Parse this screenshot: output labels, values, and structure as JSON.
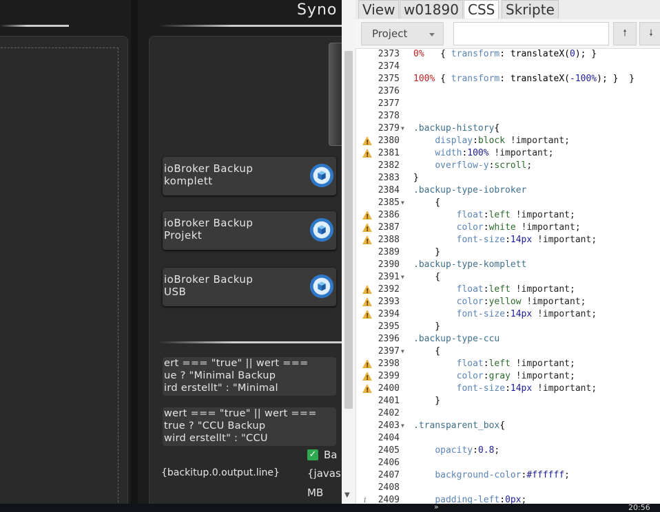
{
  "app": {
    "title": "Syno",
    "buttons": [
      {
        "label": "ioBroker Backup\nkomplett"
      },
      {
        "label": "ioBroker Backup\nProjekt"
      },
      {
        "label": "ioBroker Backup\nUSB"
      }
    ],
    "code_boxes": [
      {
        "text": "ert === \"true\" || wert ===\nue ? \"Minimal Backup\nird erstellt\" : \"Minimal"
      },
      {
        "text": "wert === \"true\" || wert ===\ntrue ? \"CCU Backup\nwird erstellt\" : \"CCU"
      }
    ],
    "output_line": "{backitup.0.output.line}",
    "checkbox_label": "Ba",
    "js_text": "{javas",
    "mb_text": "MB"
  },
  "editor": {
    "tabs": [
      "View",
      "w01890",
      "CSS",
      "Skripte"
    ],
    "active_tab": "CSS",
    "project_select": "Project",
    "search_placeholder": "",
    "nav_up": "🠕",
    "nav_down": "🠗",
    "lines": [
      {
        "n": "2373",
        "marker": "",
        "fold": false,
        "text": "0%   { transform: translateX(0); }"
      },
      {
        "n": "2374",
        "marker": "",
        "fold": false,
        "text": ""
      },
      {
        "n": "2375",
        "marker": "",
        "fold": false,
        "text": "100% { transform: translateX(-100%); }  }"
      },
      {
        "n": "2376",
        "marker": "",
        "fold": false,
        "text": ""
      },
      {
        "n": "2377",
        "marker": "",
        "fold": false,
        "text": ""
      },
      {
        "n": "2378",
        "marker": "",
        "fold": false,
        "text": ""
      },
      {
        "n": "2379",
        "marker": "",
        "fold": true,
        "text": ".backup-history{"
      },
      {
        "n": "2380",
        "marker": "warn",
        "fold": false,
        "text": "    display:block !important;"
      },
      {
        "n": "2381",
        "marker": "warn",
        "fold": false,
        "text": "    width:100% !important;"
      },
      {
        "n": "2382",
        "marker": "",
        "fold": false,
        "text": "    overflow-y:scroll;"
      },
      {
        "n": "2383",
        "marker": "",
        "fold": false,
        "text": "}"
      },
      {
        "n": "2384",
        "marker": "",
        "fold": false,
        "text": ".backup-type-iobroker"
      },
      {
        "n": "2385",
        "marker": "",
        "fold": true,
        "text": "    {"
      },
      {
        "n": "2386",
        "marker": "warn",
        "fold": false,
        "text": "        float:left !important;"
      },
      {
        "n": "2387",
        "marker": "warn",
        "fold": false,
        "text": "        color:white !important;"
      },
      {
        "n": "2388",
        "marker": "warn",
        "fold": false,
        "text": "        font-size:14px !important;"
      },
      {
        "n": "2389",
        "marker": "",
        "fold": false,
        "text": "    }"
      },
      {
        "n": "2390",
        "marker": "",
        "fold": false,
        "text": ".backup-type-komplett"
      },
      {
        "n": "2391",
        "marker": "",
        "fold": true,
        "text": "    {"
      },
      {
        "n": "2392",
        "marker": "warn",
        "fold": false,
        "text": "        float:left !important;"
      },
      {
        "n": "2393",
        "marker": "warn",
        "fold": false,
        "text": "        color:yellow !important;"
      },
      {
        "n": "2394",
        "marker": "warn",
        "fold": false,
        "text": "        font-size:14px !important;"
      },
      {
        "n": "2395",
        "marker": "",
        "fold": false,
        "text": "    }"
      },
      {
        "n": "2396",
        "marker": "",
        "fold": false,
        "text": ".backup-type-ccu"
      },
      {
        "n": "2397",
        "marker": "",
        "fold": true,
        "text": "    {"
      },
      {
        "n": "2398",
        "marker": "warn",
        "fold": false,
        "text": "        float:left !important;"
      },
      {
        "n": "2399",
        "marker": "warn",
        "fold": false,
        "text": "        color:gray !important;"
      },
      {
        "n": "2400",
        "marker": "warn",
        "fold": false,
        "text": "        font-size:14px !important;"
      },
      {
        "n": "2401",
        "marker": "",
        "fold": false,
        "text": "    }"
      },
      {
        "n": "2402",
        "marker": "",
        "fold": false,
        "text": ""
      },
      {
        "n": "2403",
        "marker": "",
        "fold": true,
        "text": ".transparent_box{"
      },
      {
        "n": "2404",
        "marker": "",
        "fold": false,
        "text": ""
      },
      {
        "n": "2405",
        "marker": "",
        "fold": false,
        "text": "    opacity:0.8;"
      },
      {
        "n": "2406",
        "marker": "",
        "fold": false,
        "text": ""
      },
      {
        "n": "2407",
        "marker": "",
        "fold": false,
        "text": "    background-color:#ffffff;"
      },
      {
        "n": "2408",
        "marker": "",
        "fold": false,
        "text": ""
      },
      {
        "n": "2409",
        "marker": "info",
        "fold": false,
        "text": "    padding-left:0px;"
      }
    ]
  },
  "taskbar": {
    "chevron": "»",
    "clock": "20:56"
  },
  "colors": {
    "app_bg": "#1c1c1c",
    "button_bg": "#3a3a3a",
    "editor_bg": "#ffffff",
    "warning": "#e8b340",
    "checkbox": "#2fa84f"
  }
}
